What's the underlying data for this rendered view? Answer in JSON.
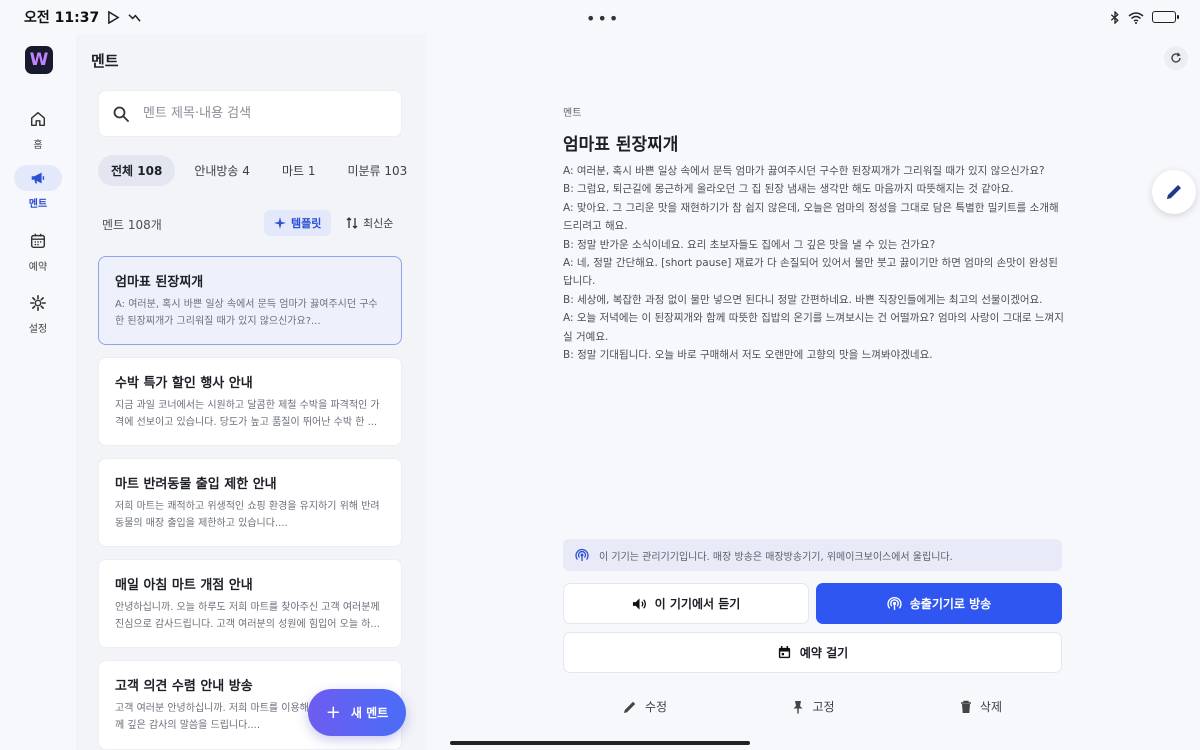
{
  "status_bar": {
    "time": "오전 11:37"
  },
  "nav": {
    "items": [
      {
        "label": "홈",
        "icon": "home-icon"
      },
      {
        "label": "멘트",
        "icon": "megaphone-icon",
        "active": true
      },
      {
        "label": "예약",
        "icon": "calendar-icon"
      },
      {
        "label": "설정",
        "icon": "gear-icon"
      }
    ]
  },
  "list": {
    "title": "멘트",
    "search_placeholder": "멘트 제목·내용 검색",
    "tabs": [
      "전체 108",
      "안내방송 4",
      "마트 1",
      "미분류 103"
    ],
    "count_label": "멘트 108개",
    "template_label": "템플릿",
    "sort_label": "최신순",
    "cards": [
      {
        "title": "엄마표 된장찌개",
        "body": "A: 여러분, 혹시 바쁜 일상 속에서 문득 엄마가 끓여주시던 구수한 된장찌개가 그리워질 때가 있지 않으신가요?..."
      },
      {
        "title": "수박 특가 할인 행사 안내",
        "body": "지금 과일 코너에서는 시원하고 달콤한 제철 수박을 파격적인 가격에 선보이고 있습니다. 당도가 높고 품질이 뛰어난 수박 한 ..."
      },
      {
        "title": "마트 반려동물 출입 제한 안내",
        "body": "저희 마트는 쾌적하고 위생적인 쇼핑 환경을 유지하기 위해 반려동물의 매장 출입을 제한하고 있습니다...."
      },
      {
        "title": "매일 아침 마트 개점 안내",
        "body": "안녕하십니까. 오늘 하루도 저희 마트를 찾아주신 고객 여러분께 진심으로 감사드립니다. 고객 여러분의 성원에 힘입어 오늘 하..."
      },
      {
        "title": "고객 의견 수렴 안내 방송",
        "body": "고객 여러분 안녕하십니까. 저희 마트를 이용해 주시는 모든 분들께 깊은 감사의 말씀을 드립니다...."
      }
    ],
    "fab_label": "새 멘트"
  },
  "detail": {
    "category": "멘트",
    "title": "엄마표 된장찌개",
    "lines": [
      "A: 여러분, 혹시 바쁜 일상 속에서 문득 엄마가 끓여주시던 구수한 된장찌개가 그리워질 때가 있지 않으신가요?",
      "B: 그럼요, 퇴근길에 몽근하게 올라오던 그 집 된장 냄새는 생각만 해도 마음까지 따뜻해지는 것 같아요.",
      "A: 맞아요. 그 그리운 맛을 재현하기가 참 쉽지 않은데, 오늘은 엄마의 정성을 그대로 담은 특별한 밀키트를 소개해 드리려고 해요.",
      "B: 정말 반가운 소식이네요. 요리 초보자들도 집에서 그 깊은 맛을 낼 수 있는 건가요?",
      "A: 네, 정말 간단해요. [short pause] 재료가 다 손질되어 있어서 물만 붓고 끓이기만 하면 엄마의 손맛이 완성된답니다.",
      "B: 세상에, 복잡한 과정 없이 물만 넣으면 된다니 정말 간편하네요. 바쁜 직장인들에게는 최고의 선물이겠어요.",
      "A: 오늘 저녁에는 이 된장찌개와 함께 따뜻한 집밥의 온기를 느껴보시는 건 어떨까요? 엄마의 사랑이 그대로 느껴지실 거예요.",
      "B: 정말 기대됩니다. 오늘 바로 구매해서 저도 오랜만에 고향의 맛을 느껴봐야겠네요."
    ],
    "notice": "이 기기는 관리기기입니다. 매장 방송은 매장방송기기, 위메이크보이스에서 울립니다.",
    "listen_label": "이 기기에서 듣기",
    "broadcast_label": "송출기기로 방송",
    "reserve_label": "예약 걸기",
    "edit_label": "수정",
    "pin_label": "고정",
    "delete_label": "삭제"
  },
  "colors": {
    "accent": "#2f56f0",
    "active_bg": "#e3e8fb"
  }
}
